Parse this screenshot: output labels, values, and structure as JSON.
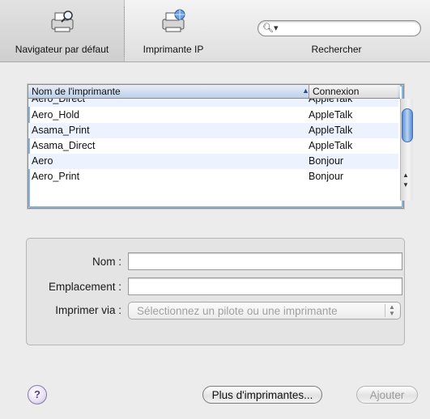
{
  "toolbar": {
    "items": [
      {
        "label": "Navigateur par défaut",
        "icon": "printer-magnifier-icon"
      },
      {
        "label": "Imprimante IP",
        "icon": "printer-globe-icon"
      },
      {
        "label": "Rechercher",
        "icon": "search-icon"
      }
    ],
    "search": {
      "placeholder": "",
      "value": ""
    }
  },
  "printer_list": {
    "columns": [
      "Nom de l'imprimante",
      "Connexion"
    ],
    "sort_indicator": "▲",
    "rows": [
      {
        "name": "Aero_Direct",
        "connection": "AppleTalk"
      },
      {
        "name": "Aero_Hold",
        "connection": "AppleTalk"
      },
      {
        "name": "Asama_Print",
        "connection": "AppleTalk"
      },
      {
        "name": "Asama_Direct",
        "connection": "AppleTalk"
      },
      {
        "name": "Aero",
        "connection": "Bonjour"
      },
      {
        "name": "Aero_Print",
        "connection": "Bonjour"
      }
    ]
  },
  "form": {
    "name_label": "Nom :",
    "name_value": "",
    "location_label": "Emplacement :",
    "location_value": "",
    "print_via_label": "Imprimer via :",
    "print_via_value": "Sélectionnez un pilote ou une imprimante"
  },
  "buttons": {
    "help": "?",
    "more_printers": "Plus d'imprimantes...",
    "add": "Ajouter"
  },
  "colors": {
    "selection_header": "#bcd0ea",
    "alt_row": "#edf3fe",
    "scroll_thumb": "#5d8fd0"
  }
}
